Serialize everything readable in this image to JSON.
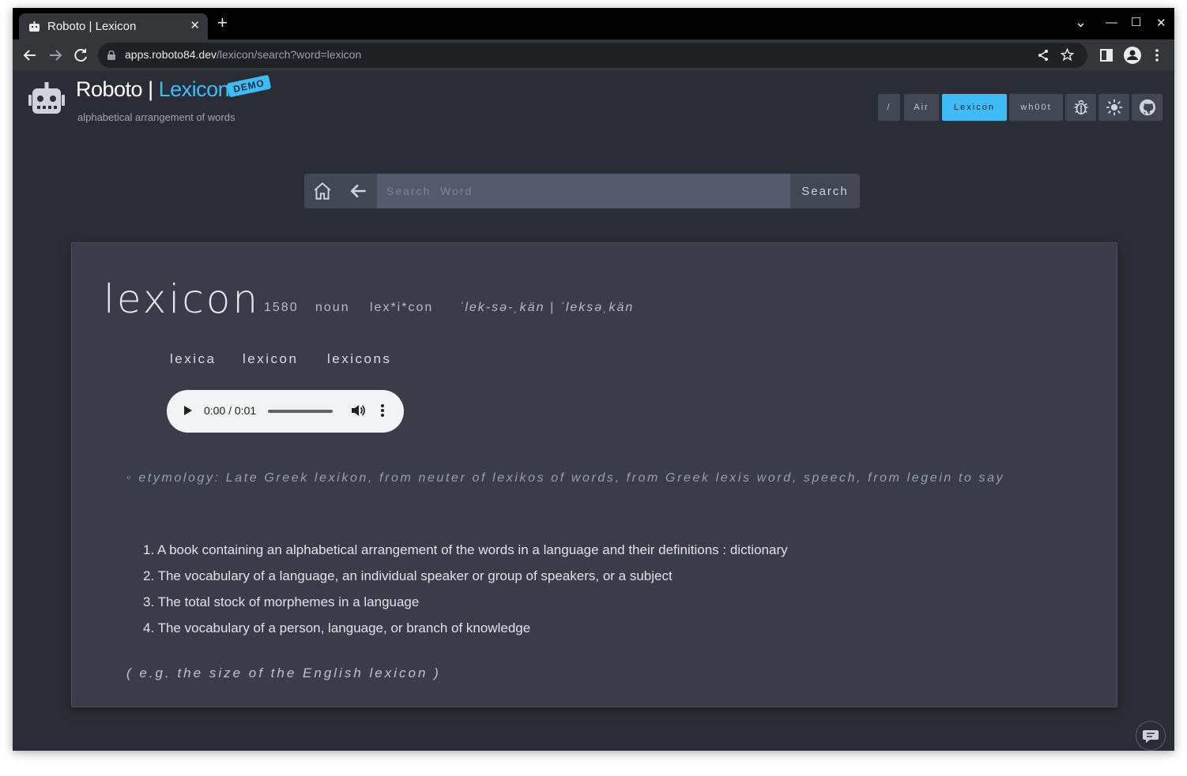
{
  "browser": {
    "tab_title": "Roboto | Lexicon",
    "tab_close": "✕",
    "new_tab": "+",
    "url_host": "apps.roboto84.dev",
    "url_path": "/lexicon/search?word=lexicon",
    "controls": {
      "minimize": "—",
      "maximize": "☐",
      "close": "✕",
      "tab_search": "⌄"
    }
  },
  "header": {
    "brand_main": "Roboto",
    "brand_sep": " | ",
    "brand_accent": "Lexicon",
    "badge": "DEMO",
    "tagline": "alphabetical arrangement of words",
    "nav": [
      "/",
      "Air",
      "Lexicon",
      "wh00t"
    ],
    "accent_color": "#3ebcf6"
  },
  "search": {
    "placeholder": "Search  Word",
    "button": "Search"
  },
  "entry": {
    "word": "lexicon",
    "year": "1580",
    "part_of_speech": "noun",
    "syllables": "lex*i*con",
    "pronunciation": "ˈlek-sə-ˌkän | ˈleksəˌkän",
    "forms": [
      "lexica",
      "lexicon",
      "lexicons"
    ],
    "audio_time": "0:00 / 0:01",
    "etymology": "◦ etymology: Late Greek lexikon, from neuter of lexikos of words, from Greek lexis word, speech, from legein to say",
    "definitions": [
      "1. A book containing an alphabetical arrangement of the words in a language and their definitions : dictionary",
      "2. The vocabulary of a language, an individual speaker or group of speakers, or a subject",
      "3. The total stock of morphemes in a language",
      "4. The vocabulary of a person, language, or branch of knowledge"
    ],
    "example": "( e.g. the size of the English lexicon )"
  }
}
